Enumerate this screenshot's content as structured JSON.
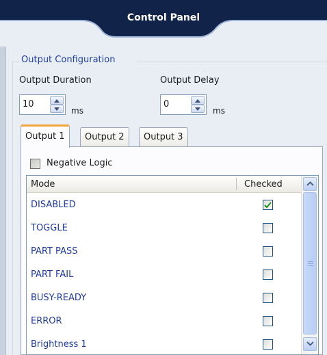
{
  "header": {
    "title": "Control Panel"
  },
  "output_config": {
    "group_label": "Output Configuration",
    "duration": {
      "label": "Output Duration",
      "value": "10",
      "unit": "ms"
    },
    "delay": {
      "label": "Output Delay",
      "value": "0",
      "unit": "ms"
    }
  },
  "tabs": [
    {
      "label": "Output 1",
      "active": true
    },
    {
      "label": "Output 2",
      "active": false
    },
    {
      "label": "Output 3",
      "active": false
    }
  ],
  "negative_logic": {
    "label": "Negative Logic",
    "checked": false
  },
  "table": {
    "columns": {
      "mode": "Mode",
      "checked": "Checked"
    },
    "rows": [
      {
        "mode": "DISABLED",
        "checked": true
      },
      {
        "mode": "TOGGLE",
        "checked": false
      },
      {
        "mode": "PART PASS",
        "checked": false
      },
      {
        "mode": "PART FAIL",
        "checked": false
      },
      {
        "mode": "BUSY-READY",
        "checked": false
      },
      {
        "mode": "ERROR",
        "checked": false
      },
      {
        "mode": "Brightness 1",
        "checked": false
      }
    ]
  },
  "icons": {
    "spin_up": "arrow-up-icon",
    "spin_down": "arrow-down-icon",
    "check": "checkmark-icon",
    "scroll_up": "scroll-up-icon",
    "scroll_down": "scroll-down-icon"
  },
  "colors": {
    "header": "#12234a",
    "accent_tab": "#f0a43c",
    "mode_text": "#1f3a9e",
    "check": "#1f8a1f"
  }
}
